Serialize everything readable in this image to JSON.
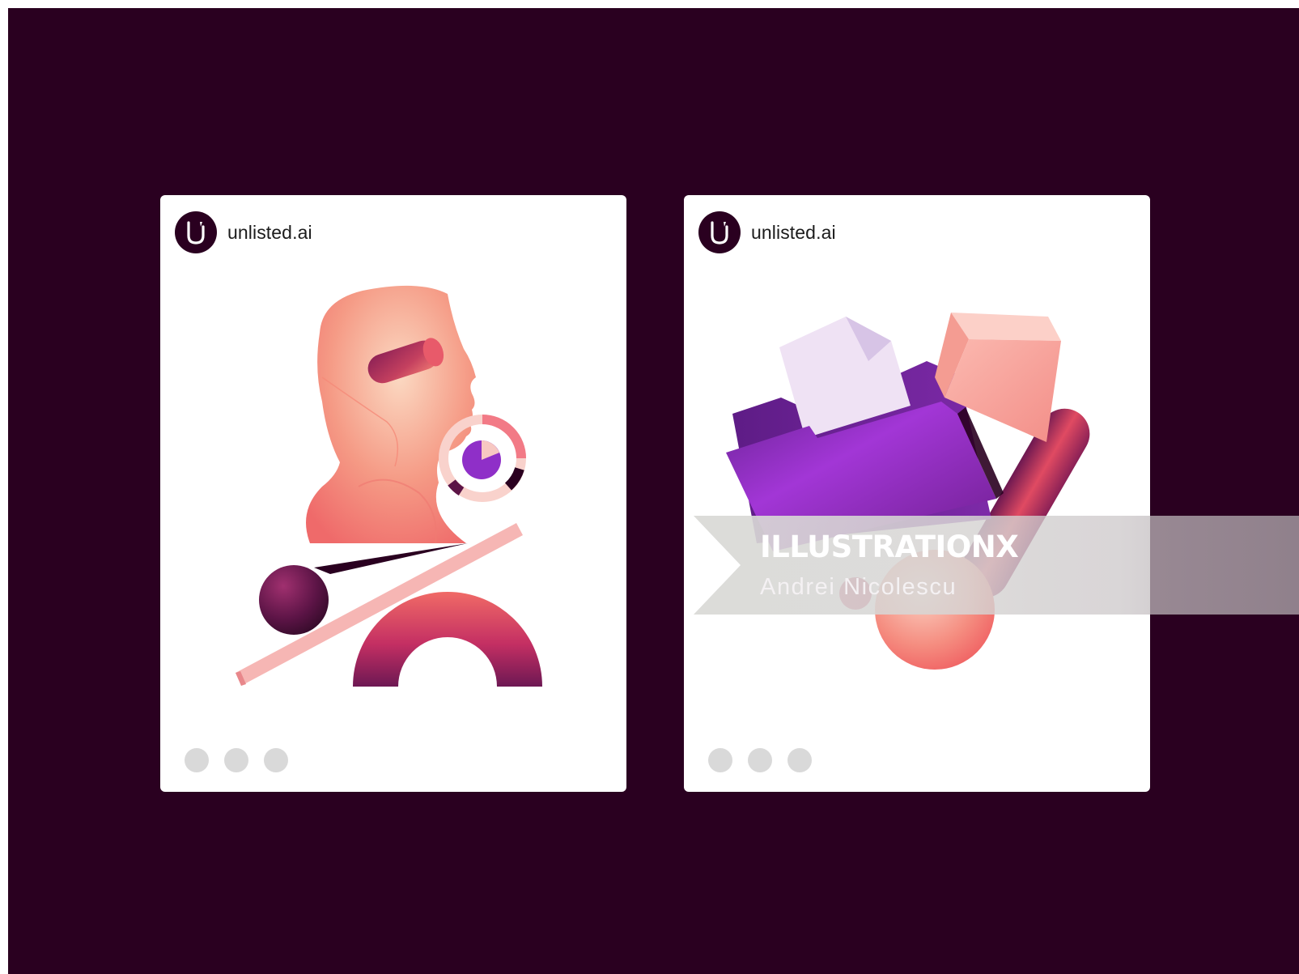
{
  "posts": [
    {
      "account": {
        "logo_letter": "U",
        "handle": "unlisted.ai"
      },
      "illustration": "human-head-with-shapes",
      "carousel_dots": 3
    },
    {
      "account": {
        "logo_letter": "U",
        "handle": "unlisted.ai"
      },
      "illustration": "folder-with-shapes",
      "carousel_dots": 3
    }
  ],
  "watermark": {
    "brand": "ILLUSTRATION",
    "brand_mark": "X",
    "artist": "Andrei Nicolescu"
  },
  "colors": {
    "background": "#2a0020",
    "card": "#ffffff",
    "dot": "#d9d9d9",
    "coral": "#f26a6a",
    "purple": "#8f2fc8",
    "plum": "#5c1446"
  }
}
